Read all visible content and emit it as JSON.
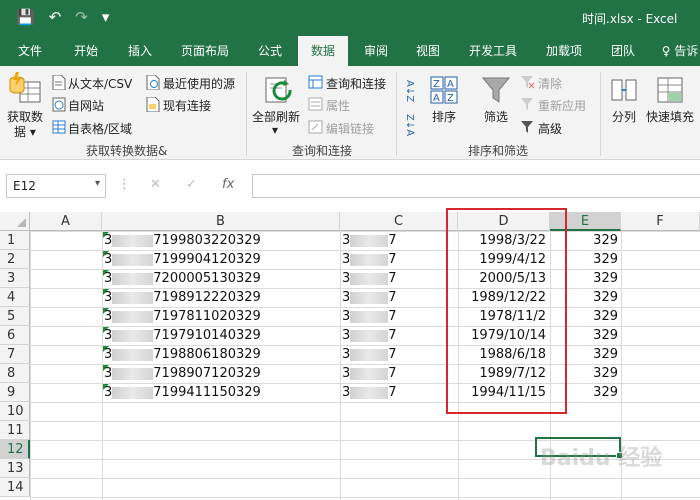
{
  "window": {
    "title": "时间.xlsx - Excel"
  },
  "quick_access": {
    "save_glyph": "💾",
    "undo_glyph": "↶",
    "redo_glyph": "↷",
    "customize_glyph": "▾"
  },
  "tabs": [
    "文件",
    "开始",
    "插入",
    "页面布局",
    "公式",
    "数据",
    "审阅",
    "视图",
    "开发工具",
    "加载项",
    "团队",
    "♀ 告诉"
  ],
  "active_tab": "数据",
  "ribbon": {
    "get_data": "获取数\n据",
    "get_data_line1": "获取数",
    "get_data_line2": "据 ▾",
    "from_text_csv": "从文本/CSV",
    "from_web": "自网站",
    "from_table": "自表格/区域",
    "recent_sources": "最近使用的源",
    "existing_connections": "现有连接",
    "group_get_transform": "获取转换数据&",
    "refresh_all_line1": "全部刷新",
    "refresh_all_line2": "▾",
    "queries_connections": "查询和连接",
    "properties": "属性",
    "edit_links": "编辑链接",
    "group_queries": "查询和连接",
    "sort_az": "A↓Z",
    "sort_za": "Z↓A",
    "sort": "排序",
    "filter": "筛选",
    "clear": "清除",
    "reapply": "重新应用",
    "advanced": "高级",
    "group_sort_filter": "排序和筛选",
    "text_to_columns": "分列",
    "flash_fill": "快速填充"
  },
  "formula_bar": {
    "name_box": "E12",
    "caret": "▾",
    "cancel": "✕",
    "enter": "✓",
    "fx": "fx",
    "dots": "⋮",
    "formula": ""
  },
  "columns": [
    "A",
    "B",
    "C",
    "D",
    "E",
    "F"
  ],
  "selected_column": "E",
  "rows": [
    "1",
    "2",
    "3",
    "4",
    "5",
    "6",
    "7",
    "8",
    "9",
    "10",
    "11",
    "12",
    "13",
    "14"
  ],
  "selected_row": "12",
  "data_rows": [
    {
      "b_prefix": "3",
      "b_suffix": "7199803220329",
      "c_prefix": "3",
      "c_suffix": "7",
      "d": "1998/3/22",
      "e": "329"
    },
    {
      "b_prefix": "3",
      "b_suffix": "7199904120329",
      "c_prefix": "3",
      "c_suffix": "7",
      "d": "1999/4/12",
      "e": "329"
    },
    {
      "b_prefix": "3",
      "b_suffix": "7200005130329",
      "c_prefix": "3",
      "c_suffix": "7",
      "d": "2000/5/13",
      "e": "329"
    },
    {
      "b_prefix": "3",
      "b_suffix": "7198912220329",
      "c_prefix": "3",
      "c_suffix": "7",
      "d": "1989/12/22",
      "e": "329"
    },
    {
      "b_prefix": "3",
      "b_suffix": "7197811020329",
      "c_prefix": "3",
      "c_suffix": "7",
      "d": "1978/11/2",
      "e": "329"
    },
    {
      "b_prefix": "3",
      "b_suffix": "7197910140329",
      "c_prefix": "3",
      "c_suffix": "7",
      "d": "1979/10/14",
      "e": "329"
    },
    {
      "b_prefix": "3",
      "b_suffix": "7198806180329",
      "c_prefix": "3",
      "c_suffix": "7",
      "d": "1988/6/18",
      "e": "329"
    },
    {
      "b_prefix": "3",
      "b_suffix": "7198907120329",
      "c_prefix": "3",
      "c_suffix": "7",
      "d": "1989/7/12",
      "e": "329"
    },
    {
      "b_prefix": "3",
      "b_suffix": "7199411150329",
      "c_prefix": "3",
      "c_suffix": "7",
      "d": "1994/11/15",
      "e": "329"
    }
  ],
  "colors": {
    "excel_green": "#217346",
    "highlight_red": "#d7262e",
    "error_triangle": "#1e8a3a"
  },
  "watermark": "Baidu 经验"
}
